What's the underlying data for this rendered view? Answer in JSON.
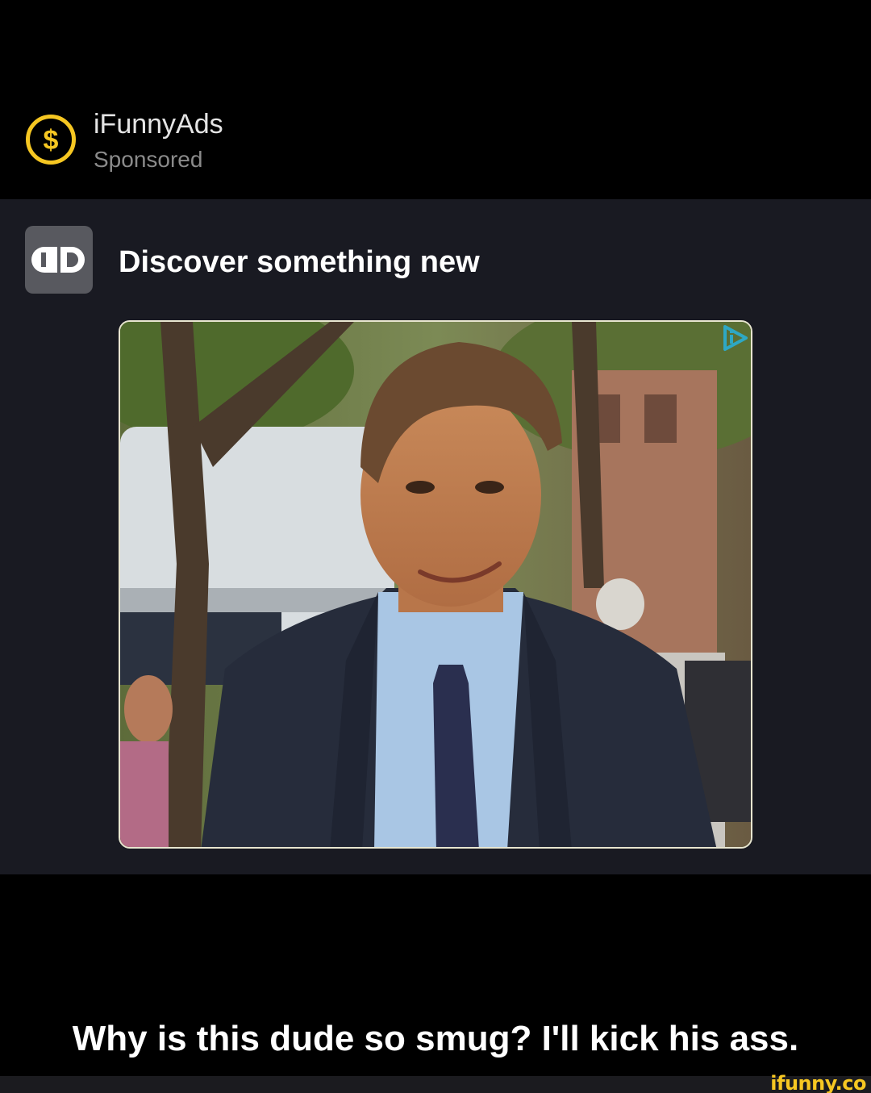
{
  "sponsor": {
    "name": "iFunnyAds",
    "label": "Sponsored",
    "icon": "dollar-coin-icon"
  },
  "ad": {
    "app_logo_icon": "dd-logo-icon",
    "headline": "Discover something new",
    "image_subject": "photo-of-smiling-man-in-suit",
    "adchoices_icon": "adchoices-icon"
  },
  "post": {
    "caption": "Why is this dude so smug? I'll kick his ass."
  },
  "watermark": {
    "text": "ifunny.co"
  },
  "colors": {
    "accent": "#f6c722",
    "card_background": "#191a22",
    "page_background": "#000000",
    "adchoices": "#2ea8c4"
  }
}
